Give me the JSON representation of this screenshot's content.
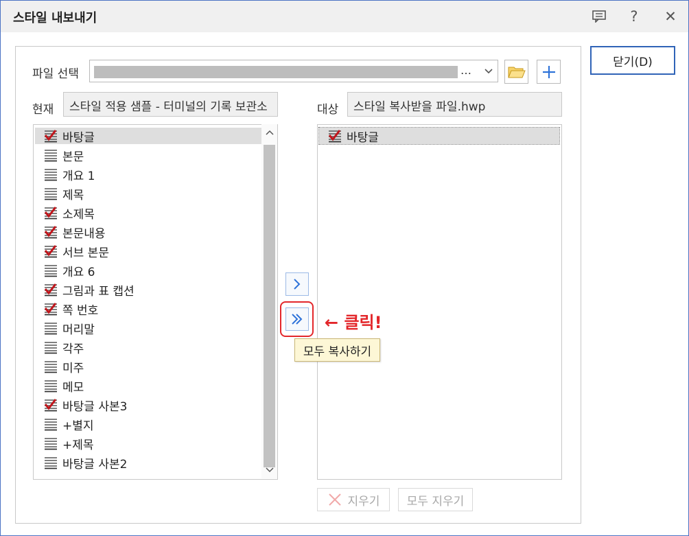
{
  "window": {
    "title": "스타일 내보내기"
  },
  "titlebar": {
    "feedback_icon": "comment-icon",
    "help_label": "?",
    "close_label": "✕"
  },
  "close_button": {
    "label": "닫기(D)"
  },
  "file_select": {
    "label": "파일 선택",
    "value_visible_suffix": "…"
  },
  "current": {
    "label": "현재",
    "value": "스타일 적용 샘플 - 터미널의 기록 보관소"
  },
  "target": {
    "label": "대상",
    "value": "스타일 복사받을 파일.hwp"
  },
  "source_list": [
    {
      "label": "바탕글",
      "checked": true
    },
    {
      "label": "본문",
      "checked": false
    },
    {
      "label": "개요 1",
      "checked": false
    },
    {
      "label": "제목",
      "checked": false
    },
    {
      "label": "소제목",
      "checked": true
    },
    {
      "label": "본문내용",
      "checked": true
    },
    {
      "label": "서브 본문",
      "checked": true
    },
    {
      "label": "개요 6",
      "checked": false
    },
    {
      "label": "그림과 표 캡션",
      "checked": true
    },
    {
      "label": "쪽 번호",
      "checked": true
    },
    {
      "label": "머리말",
      "checked": false
    },
    {
      "label": "각주",
      "checked": false
    },
    {
      "label": "미주",
      "checked": false
    },
    {
      "label": "메모",
      "checked": false
    },
    {
      "label": "바탕글 사본3",
      "checked": true
    },
    {
      "label": "+별지",
      "checked": false
    },
    {
      "label": "+제목",
      "checked": false
    },
    {
      "label": "바탕글 사본2",
      "checked": false
    }
  ],
  "target_list": [
    {
      "label": "바탕글",
      "checked": true
    }
  ],
  "move_buttons": {
    "copy_one": "›",
    "copy_all": "»"
  },
  "tooltip": "모두 복사하기",
  "annotation": "← 클릭!",
  "bottom_buttons": {
    "delete": "지우기",
    "delete_all": "모두 지우기"
  },
  "colors": {
    "accent": "#2f63b7",
    "annotation": "#e3262a",
    "check": "#c0151b",
    "selection": "#dedede"
  }
}
